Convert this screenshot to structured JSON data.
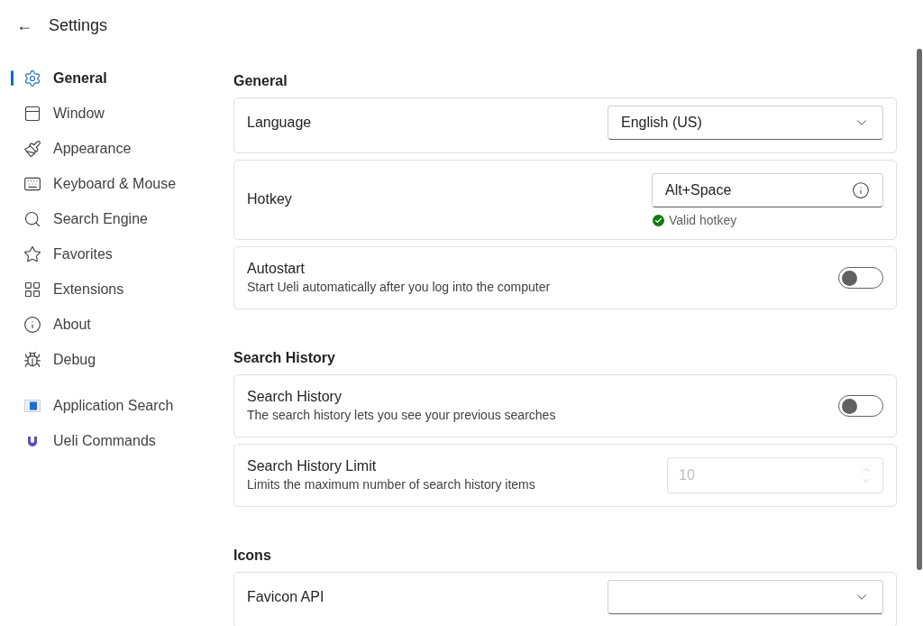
{
  "header": {
    "back": "←",
    "title": "Settings"
  },
  "nav": [
    {
      "label": "General",
      "selected": true
    },
    {
      "label": "Window",
      "selected": false
    },
    {
      "label": "Appearance",
      "selected": false
    },
    {
      "label": "Keyboard & Mouse",
      "selected": false
    },
    {
      "label": "Search Engine",
      "selected": false
    },
    {
      "label": "Favorites",
      "selected": false
    },
    {
      "label": "Extensions",
      "selected": false
    },
    {
      "label": "About",
      "selected": false
    },
    {
      "label": "Debug",
      "selected": false
    }
  ],
  "extensions": [
    {
      "label": "Application Search",
      "selected": false
    },
    {
      "label": "Ueli Commands",
      "selected": false
    }
  ],
  "sections": [
    {
      "title": "General",
      "settings": [
        {
          "kind": "select",
          "label": "Language",
          "value": "English (US)"
        },
        {
          "kind": "hotkey",
          "label": "Hotkey",
          "value": "Alt+Space",
          "validation": "Valid hotkey"
        },
        {
          "kind": "toggle",
          "label": "Autostart",
          "description": "Start Ueli automatically after you log into the computer",
          "on": false
        }
      ]
    },
    {
      "title": "Search History",
      "settings": [
        {
          "kind": "toggle",
          "label": "Search History",
          "description": "The search history lets you see your previous searches",
          "on": false
        },
        {
          "kind": "number",
          "label": "Search History Limit",
          "description": "Limits the maximum number of search history items",
          "value": "10",
          "disabled": true
        }
      ]
    },
    {
      "title": "Icons",
      "settings": [
        {
          "kind": "select",
          "label": "Favicon API"
        }
      ]
    }
  ]
}
